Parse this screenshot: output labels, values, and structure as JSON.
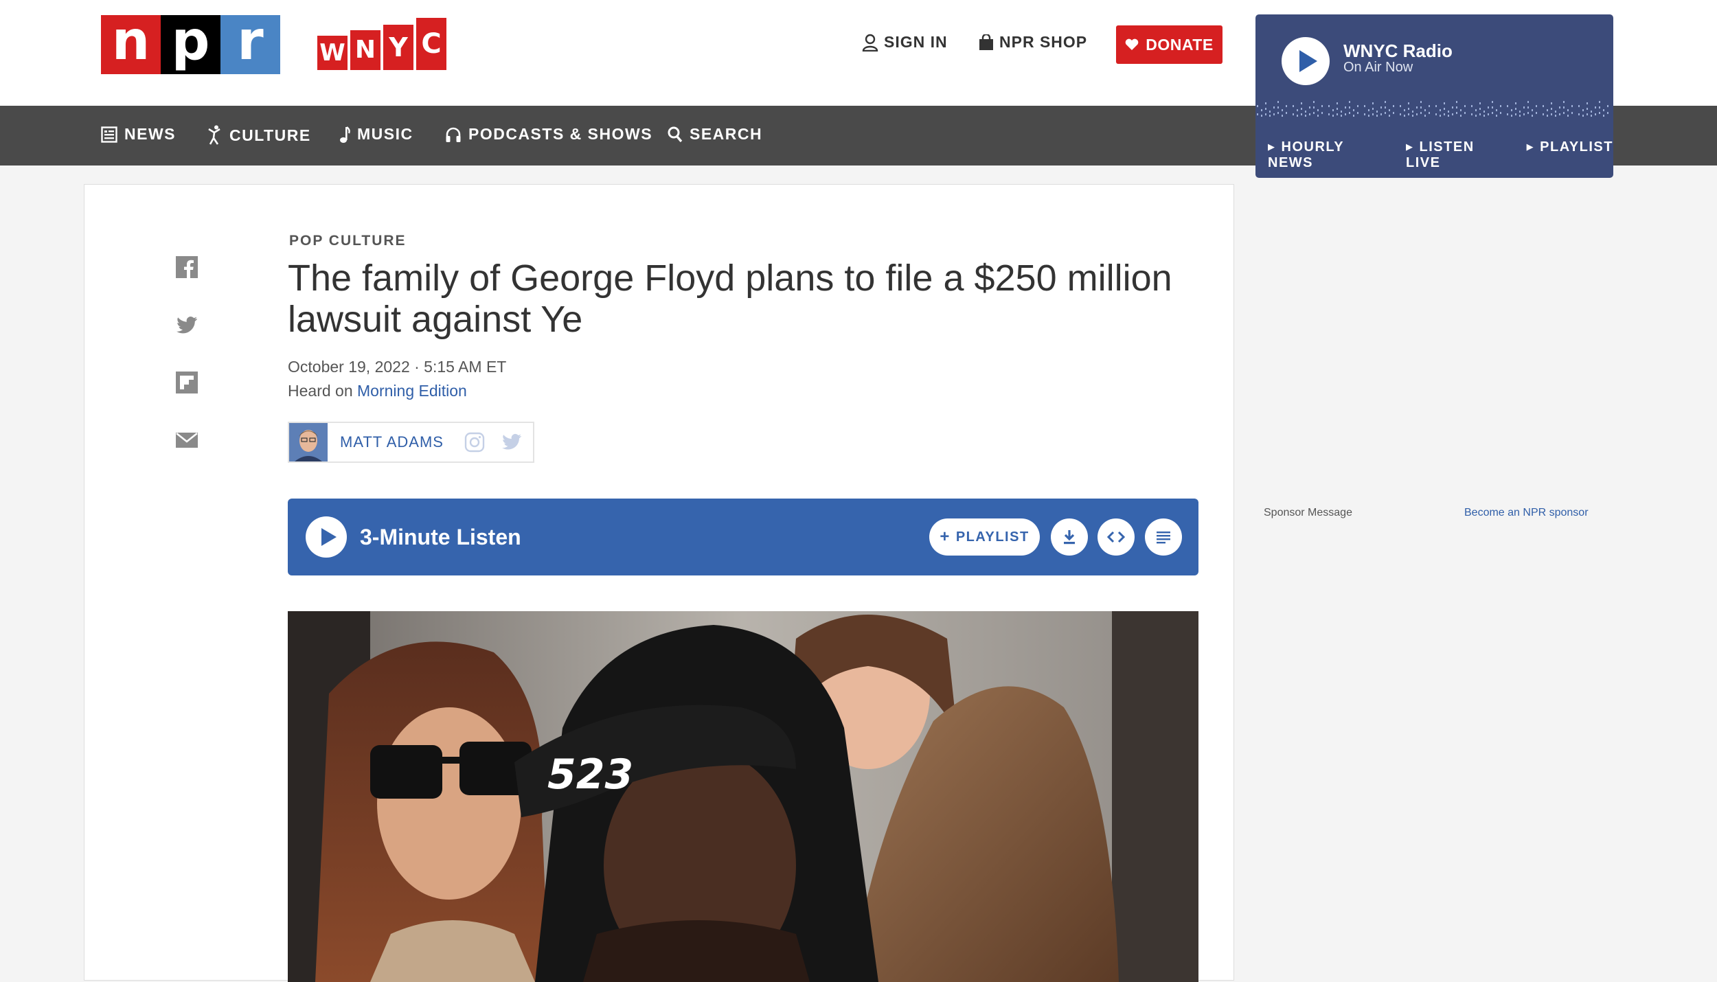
{
  "header": {
    "npr_logo": [
      "n",
      "p",
      "r"
    ],
    "wnyc_logo": [
      "W",
      "N",
      "Y",
      "C"
    ],
    "sign_in": "SIGN IN",
    "shop": "NPR SHOP",
    "donate": "DONATE"
  },
  "nav": {
    "items": [
      "NEWS",
      "CULTURE",
      "MUSIC",
      "PODCASTS & SHOWS",
      "SEARCH"
    ]
  },
  "radio": {
    "title": "WNYC Radio",
    "subtitle": "On Air Now",
    "links": [
      "HOURLY NEWS",
      "LISTEN LIVE",
      "PLAYLIST"
    ]
  },
  "article": {
    "section": "POP CULTURE",
    "headline": "The family of George Floyd plans to file a $250 million lawsuit against Ye",
    "date": "October 19, 2022 · 5:15 AM ET",
    "heard_prefix": "Heard on ",
    "heard_show": "Morning Edition",
    "author": "MATT ADAMS",
    "photo_cap_text": "523"
  },
  "player": {
    "label": "3-Minute Listen",
    "playlist": "PLAYLIST"
  },
  "sponsor": {
    "message": "Sponsor Message",
    "link": "Become an NPR sponsor"
  },
  "colors": {
    "npr_red": "#d62021",
    "npr_black": "#000000",
    "npr_blue": "#4a85c5",
    "nav_bg": "#4a4a4a",
    "radio_bg": "#3c4b7a",
    "player_bg": "#3664ad",
    "link": "#2f5ea8"
  }
}
